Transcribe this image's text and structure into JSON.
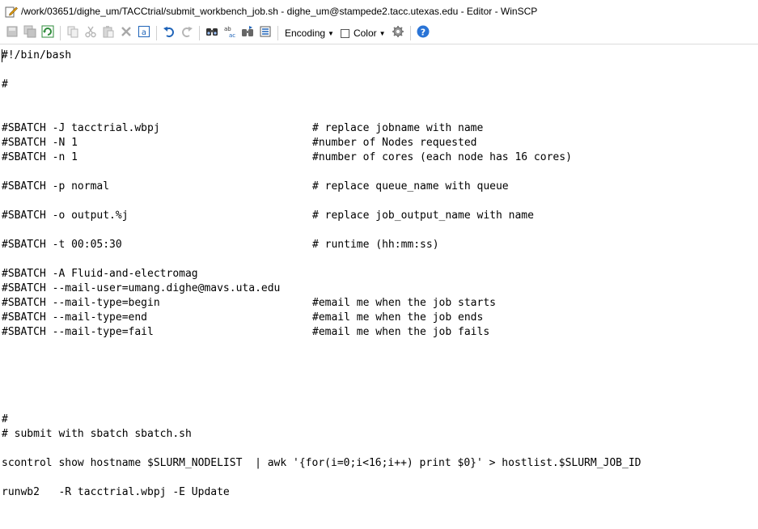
{
  "window": {
    "title": "/work/03651/dighe_um/TACCtrial/submit_workbench_job.sh - dighe_um@stampede2.tacc.utexas.edu - Editor - WinSCP"
  },
  "toolbar": {
    "encoding_label": "Encoding",
    "color_label": "Color",
    "color_checked": false
  },
  "editor": {
    "lines": [
      {
        "code": "#!/bin/bash",
        "comment": ""
      },
      {
        "code": "",
        "comment": ""
      },
      {
        "code": "#",
        "comment": ""
      },
      {
        "code": "",
        "comment": ""
      },
      {
        "code": "",
        "comment": ""
      },
      {
        "code": "#SBATCH -J tacctrial.wbpj",
        "comment": "# replace jobname with name"
      },
      {
        "code": "#SBATCH -N 1",
        "comment": "#number of Nodes requested"
      },
      {
        "code": "#SBATCH -n 1",
        "comment": "#number of cores (each node has 16 cores)"
      },
      {
        "code": "",
        "comment": ""
      },
      {
        "code": "#SBATCH -p normal",
        "comment": "# replace queue_name with queue"
      },
      {
        "code": "",
        "comment": ""
      },
      {
        "code": "#SBATCH -o output.%j",
        "comment": "# replace job_output_name with name"
      },
      {
        "code": "",
        "comment": ""
      },
      {
        "code": "#SBATCH -t 00:05:30",
        "comment": "# runtime (hh:mm:ss)"
      },
      {
        "code": "",
        "comment": ""
      },
      {
        "code": "#SBATCH -A Fluid-and-electromag",
        "comment": ""
      },
      {
        "code": "#SBATCH --mail-user=umang.dighe@mavs.uta.edu",
        "comment": ""
      },
      {
        "code": "#SBATCH --mail-type=begin",
        "comment": "#email me when the job starts"
      },
      {
        "code": "#SBATCH --mail-type=end",
        "comment": "#email me when the job ends"
      },
      {
        "code": "#SBATCH --mail-type=fail",
        "comment": "#email me when the job fails"
      },
      {
        "code": "",
        "comment": ""
      },
      {
        "code": "",
        "comment": ""
      },
      {
        "code": "",
        "comment": ""
      },
      {
        "code": "",
        "comment": ""
      },
      {
        "code": "",
        "comment": ""
      },
      {
        "code": "#",
        "comment": ""
      },
      {
        "code": "# submit with sbatch sbatch.sh",
        "comment": ""
      },
      {
        "code": "",
        "comment": ""
      },
      {
        "code": "scontrol show hostname $SLURM_NODELIST  | awk '{for(i=0;i<16;i++) print $0}' > hostlist.$SLURM_JOB_ID",
        "comment": ""
      },
      {
        "code": "",
        "comment": ""
      },
      {
        "code": "runwb2   -R tacctrial.wbpj -E Update",
        "comment": ""
      }
    ]
  },
  "colors": {
    "accent_blue": "#1e63b8",
    "help_blue": "#2a74d6",
    "refresh_green": "#2e8b3a",
    "disabled_gray": "#b5b5b5"
  },
  "icons": [
    "edit-icon",
    "save-icon",
    "save-all-icon",
    "reload-icon",
    "copy-icon",
    "cut-icon",
    "paste-icon",
    "delete-icon",
    "select-all-icon",
    "undo-icon",
    "redo-icon",
    "find-icon",
    "replace-icon",
    "find-next-icon",
    "goto-line-icon",
    "settings-icon",
    "help-icon"
  ]
}
